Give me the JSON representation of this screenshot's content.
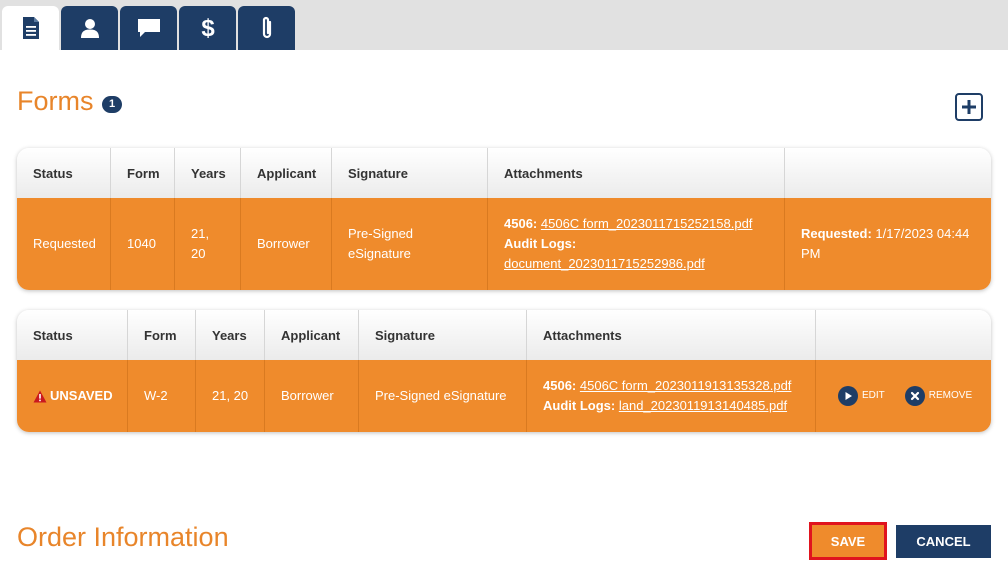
{
  "tabs": [
    {
      "icon": "document-icon",
      "active": true
    },
    {
      "icon": "user-icon",
      "active": false
    },
    {
      "icon": "chat-icon",
      "active": false
    },
    {
      "icon": "dollar-icon",
      "active": false
    },
    {
      "icon": "paperclip-icon",
      "active": false
    }
  ],
  "forms": {
    "title": "Forms",
    "count": "1",
    "add_icon": "plus-square-icon"
  },
  "table1": {
    "headers": [
      "Status",
      "Form",
      "Years",
      "Applicant",
      "Signature",
      "Attachments",
      ""
    ],
    "row": {
      "status": "Requested",
      "form": "1040",
      "years_line1": "21,",
      "years_line2": "20",
      "applicant": "Borrower",
      "signature_line1": "Pre-Signed",
      "signature_line2": "eSignature",
      "att_label1": "4506:",
      "att_link1": "4506C form_2023011715252158.pdf",
      "att_label2": "Audit Logs:",
      "att_link2": "document_2023011715252986.pdf",
      "requested_label": "Requested:",
      "requested_value": "1/17/2023 04:44",
      "requested_value2": "PM"
    }
  },
  "table2": {
    "headers": [
      "Status",
      "Form",
      "Years",
      "Applicant",
      "Signature",
      "Attachments",
      ""
    ],
    "row": {
      "status": "UNSAVED",
      "status_icon": "warning-icon",
      "form": "W-2",
      "years": "21, 20",
      "applicant": "Borrower",
      "signature": "Pre-Signed eSignature",
      "att_label1": "4506:",
      "att_link1": "4506C form_2023011913135328.pdf",
      "att_label2": "Audit Logs:",
      "att_link2": "land_2023011913140485.pdf",
      "edit_label": "EDIT",
      "remove_label": "REMOVE"
    }
  },
  "order": {
    "title": "Order Information"
  },
  "buttons": {
    "save": "SAVE",
    "cancel": "CANCEL"
  },
  "colors": {
    "accent_orange": "#ef8b2c",
    "title_orange": "#e8852a",
    "navy": "#1e3d66",
    "highlight_red": "#e0141e"
  }
}
